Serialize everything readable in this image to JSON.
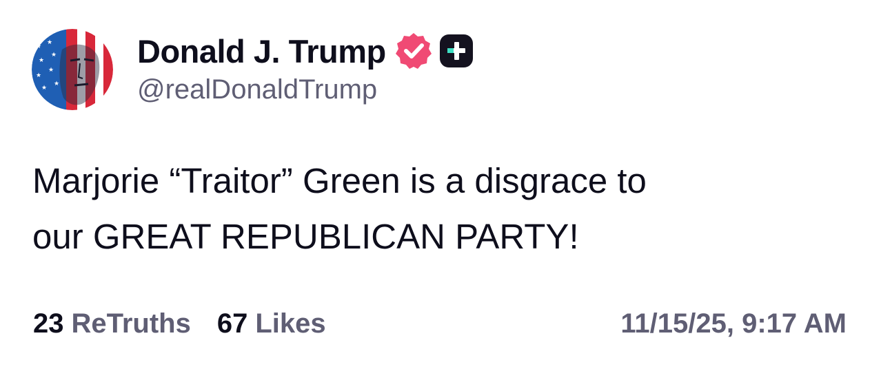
{
  "post": {
    "author": {
      "display_name": "Donald J. Trump",
      "handle": "@realDonaldTrump",
      "avatar_icon": "portrait-with-american-flag-avatar",
      "verified_icon": "verified-badge-icon",
      "plus_icon": "truth-plus-icon"
    },
    "text_lines": [
      "Marjorie “Traitor” Green is a disgrace to",
      "our GREAT REPUBLICAN PARTY!"
    ],
    "stats": {
      "retruths_count": "23",
      "retruths_label": "ReTruths",
      "likes_count": "67",
      "likes_label": "Likes"
    },
    "timestamp": "11/15/25, 9:17 AM"
  },
  "colors": {
    "text_primary": "#0e0e1c",
    "text_secondary": "#5f5e74",
    "verified_badge": "#f04a74",
    "plus_badge": "#14121f",
    "plus_accent": "#3ee0c4",
    "background": "#ffffff"
  }
}
